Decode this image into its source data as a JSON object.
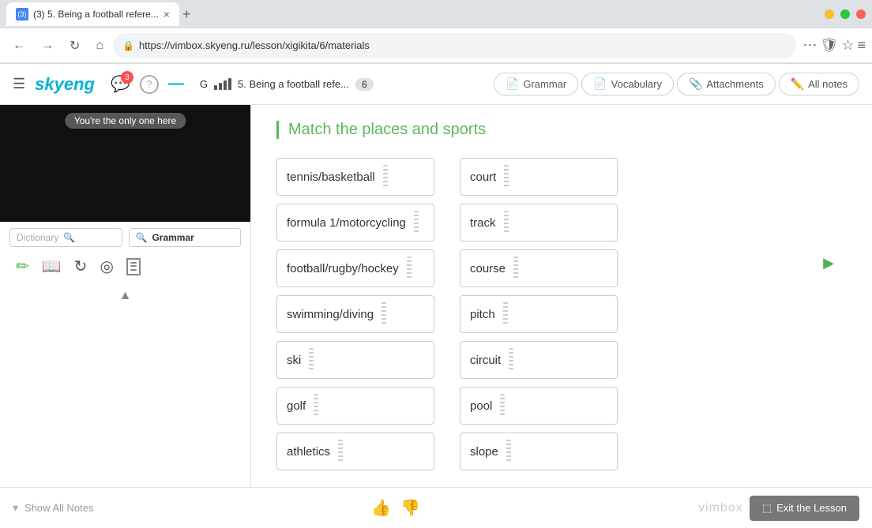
{
  "browser": {
    "tab_favicon": "(3)",
    "tab_title": "(3) 5. Being a football refere...",
    "tab_close": "×",
    "tab_new": "+",
    "url": "https://vimbox.skyeng.ru/lesson/xigikita/6/materials",
    "back_btn": "←",
    "forward_btn": "→",
    "reload_btn": "↻",
    "home_btn": "⌂",
    "menu_btn": "⋯",
    "shield_btn": "🛡",
    "star_btn": "☆",
    "hamburger_btn": "≡"
  },
  "app_header": {
    "hamburger": "☰",
    "logo": "skyeng",
    "notif_count": "3",
    "help_label": "?",
    "minimize_label": "—",
    "lesson_g": "G",
    "signal_bars": [
      3,
      4,
      4,
      5
    ],
    "lesson_title": "5. Being a football refe...",
    "lesson_number": "6",
    "tabs": [
      {
        "label": "Grammar",
        "icon": "📄"
      },
      {
        "label": "Vocabulary",
        "icon": "📄"
      },
      {
        "label": "Attachments",
        "icon": "📎"
      },
      {
        "label": "All notes",
        "icon": "✏️"
      }
    ]
  },
  "sidebar": {
    "you_only_text": "You're the only one here",
    "dictionary_placeholder": "Dictionary",
    "grammar_label": "Grammar",
    "tools": [
      {
        "name": "pencil",
        "label": "✏"
      },
      {
        "name": "book",
        "label": "📖"
      },
      {
        "name": "refresh",
        "label": "↻"
      },
      {
        "name": "target",
        "label": "◎"
      }
    ],
    "collapse_up": "▲"
  },
  "exercise": {
    "title": "Match the places and sports",
    "sports": [
      "tennis/basketball",
      "formula 1/motorcycling",
      "football/rugby/hockey",
      "swimming/diving",
      "ski",
      "golf",
      "athletics"
    ],
    "places": [
      "court",
      "track",
      "course",
      "pitch",
      "circuit",
      "pool",
      "slope"
    ]
  },
  "footer": {
    "show_notes": "Show All Notes",
    "collapse_chevron": "▾",
    "vimbox_logo": "vimbox",
    "exit_label": "Exit the Lesson",
    "exit_icon": "⬚"
  }
}
